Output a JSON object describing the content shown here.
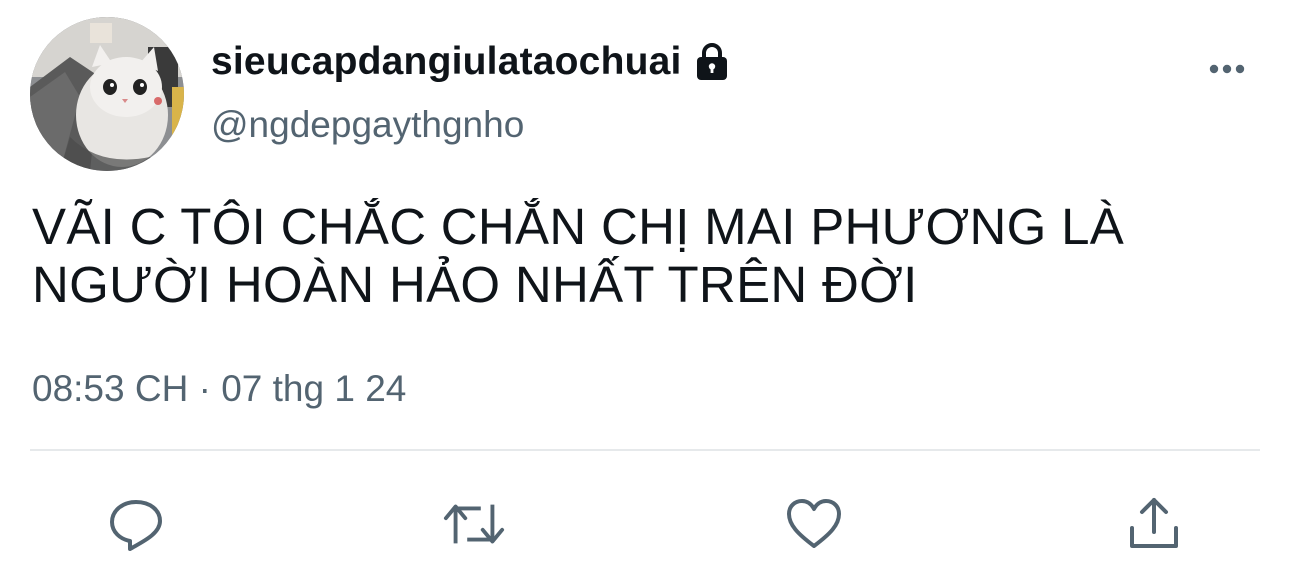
{
  "tweet": {
    "display_name": "sieucapdangiulataochuai",
    "handle": "@ngdepgaythgnho",
    "text_lines": [
      "VÃI C TÔI CHẮC CHẮN CHỊ MAI PHƯƠNG LÀ",
      "NGƯỜI HOÀN HẢO NHẤT TRÊN ĐỜI"
    ],
    "timestamp": "08:53 CH · 07 thg 1 24",
    "protected": true
  },
  "icons": {
    "avatar": "cat-avatar",
    "lock": "lock-icon",
    "more": "more-icon",
    "reply": "reply-icon",
    "retweet": "retweet-icon",
    "like": "heart-icon",
    "share": "share-icon"
  },
  "colors": {
    "primary_text": "#0f1419",
    "secondary_text": "#536471",
    "divider": "#e6e9eb",
    "icon": "#536471"
  }
}
